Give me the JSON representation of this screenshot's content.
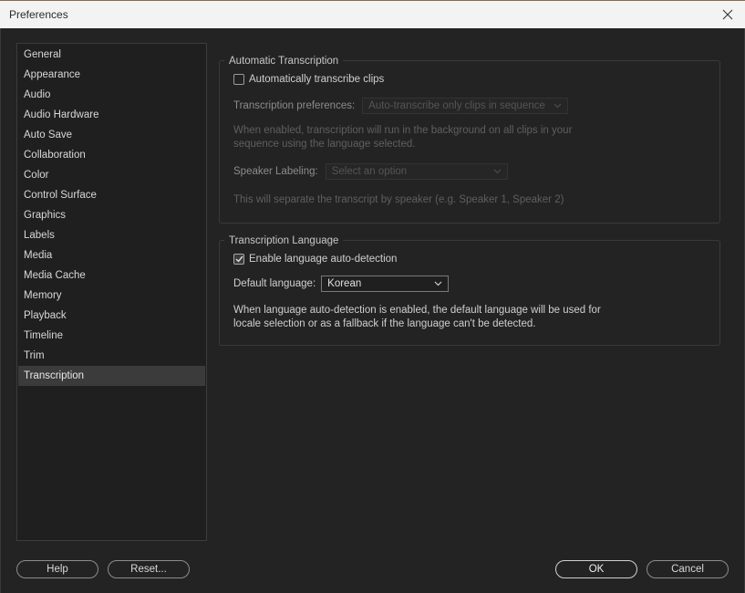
{
  "window": {
    "title": "Preferences",
    "close_icon": "close-icon"
  },
  "sidebar": {
    "items": [
      {
        "label": "General"
      },
      {
        "label": "Appearance"
      },
      {
        "label": "Audio"
      },
      {
        "label": "Audio Hardware"
      },
      {
        "label": "Auto Save"
      },
      {
        "label": "Collaboration"
      },
      {
        "label": "Color"
      },
      {
        "label": "Control Surface"
      },
      {
        "label": "Graphics"
      },
      {
        "label": "Labels"
      },
      {
        "label": "Media"
      },
      {
        "label": "Media Cache"
      },
      {
        "label": "Memory"
      },
      {
        "label": "Playback"
      },
      {
        "label": "Timeline"
      },
      {
        "label": "Trim"
      },
      {
        "label": "Transcription"
      }
    ],
    "selected": "Transcription"
  },
  "auto_transcription": {
    "title": "Automatic Transcription",
    "auto_checkbox_label": "Automatically transcribe clips",
    "auto_checked": false,
    "prefs_label": "Transcription preferences:",
    "prefs_value": "Auto-transcribe only clips in sequence",
    "prefs_desc_line1": "When enabled, transcription will run in the background on all clips in your",
    "prefs_desc_line2": "sequence using the language selected.",
    "speaker_label": "Speaker Labeling:",
    "speaker_placeholder": "Select an option",
    "speaker_desc": "This will separate the transcript by speaker (e.g. Speaker 1, Speaker 2)"
  },
  "transcription_language": {
    "title": "Transcription Language",
    "detect_label": "Enable language auto-detection",
    "detect_checked": true,
    "default_label": "Default language:",
    "default_value": "Korean",
    "desc_line1": "When language auto-detection is enabled, the default language will be used for",
    "desc_line2": "locale selection or as a fallback if the language can't be detected."
  },
  "footer": {
    "help": "Help",
    "reset": "Reset...",
    "ok": "OK",
    "cancel": "Cancel"
  }
}
